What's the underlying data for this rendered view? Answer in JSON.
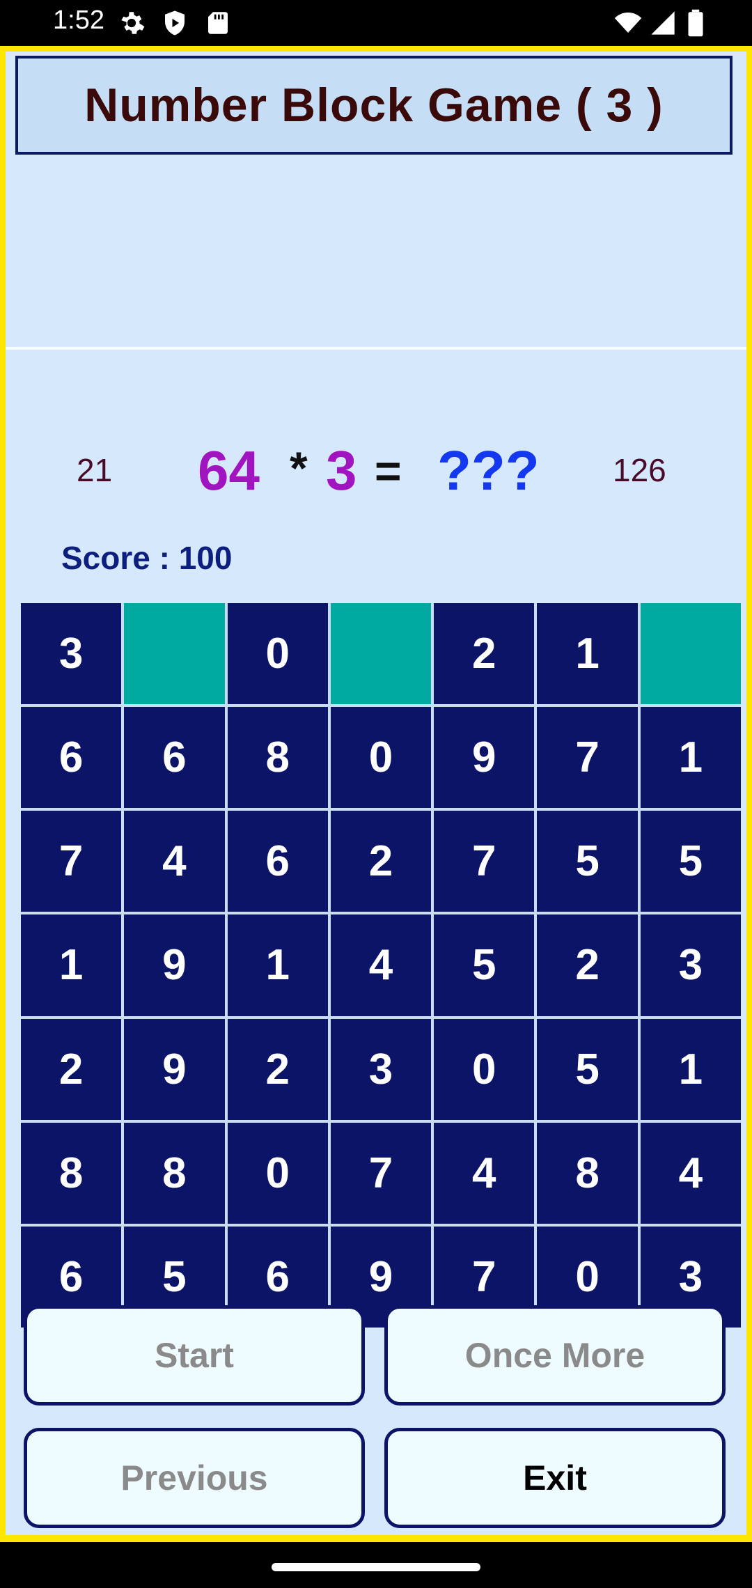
{
  "status_bar": {
    "time": "1:52",
    "icons_left": [
      "settings-gear-icon",
      "shield-play-icon",
      "sd-card-icon"
    ],
    "icons_right": [
      "wifi-icon",
      "cell-signal-icon",
      "battery-icon"
    ]
  },
  "header": {
    "title": "Number Block Game ( 3 )"
  },
  "equation": {
    "left_hint": "21",
    "operand_a": "64",
    "operator": "*",
    "operand_b": "3",
    "equals": "=",
    "answer": "???",
    "right_hint": "126"
  },
  "score": {
    "label": "Score : 100"
  },
  "grid": {
    "rows": [
      [
        "3",
        "",
        "0",
        "",
        "2",
        "1",
        ""
      ],
      [
        "6",
        "6",
        "8",
        "0",
        "9",
        "7",
        "1"
      ],
      [
        "7",
        "4",
        "6",
        "2",
        "7",
        "5",
        "5"
      ],
      [
        "1",
        "9",
        "1",
        "4",
        "5",
        "2",
        "3"
      ],
      [
        "2",
        "9",
        "2",
        "3",
        "0",
        "5",
        "1"
      ],
      [
        "8",
        "8",
        "0",
        "7",
        "4",
        "8",
        "4"
      ],
      [
        "6",
        "5",
        "6",
        "9",
        "7",
        "0",
        "3"
      ]
    ]
  },
  "buttons": {
    "start": "Start",
    "once_more": "Once More",
    "previous": "Previous",
    "exit": "Exit"
  },
  "colors": {
    "frame": "#ffe600",
    "background": "#d6e8fb",
    "cell": "#0b1466",
    "empty_cell": "#00aaa0",
    "operand": "#a015c0",
    "unknown": "#1438f0"
  }
}
